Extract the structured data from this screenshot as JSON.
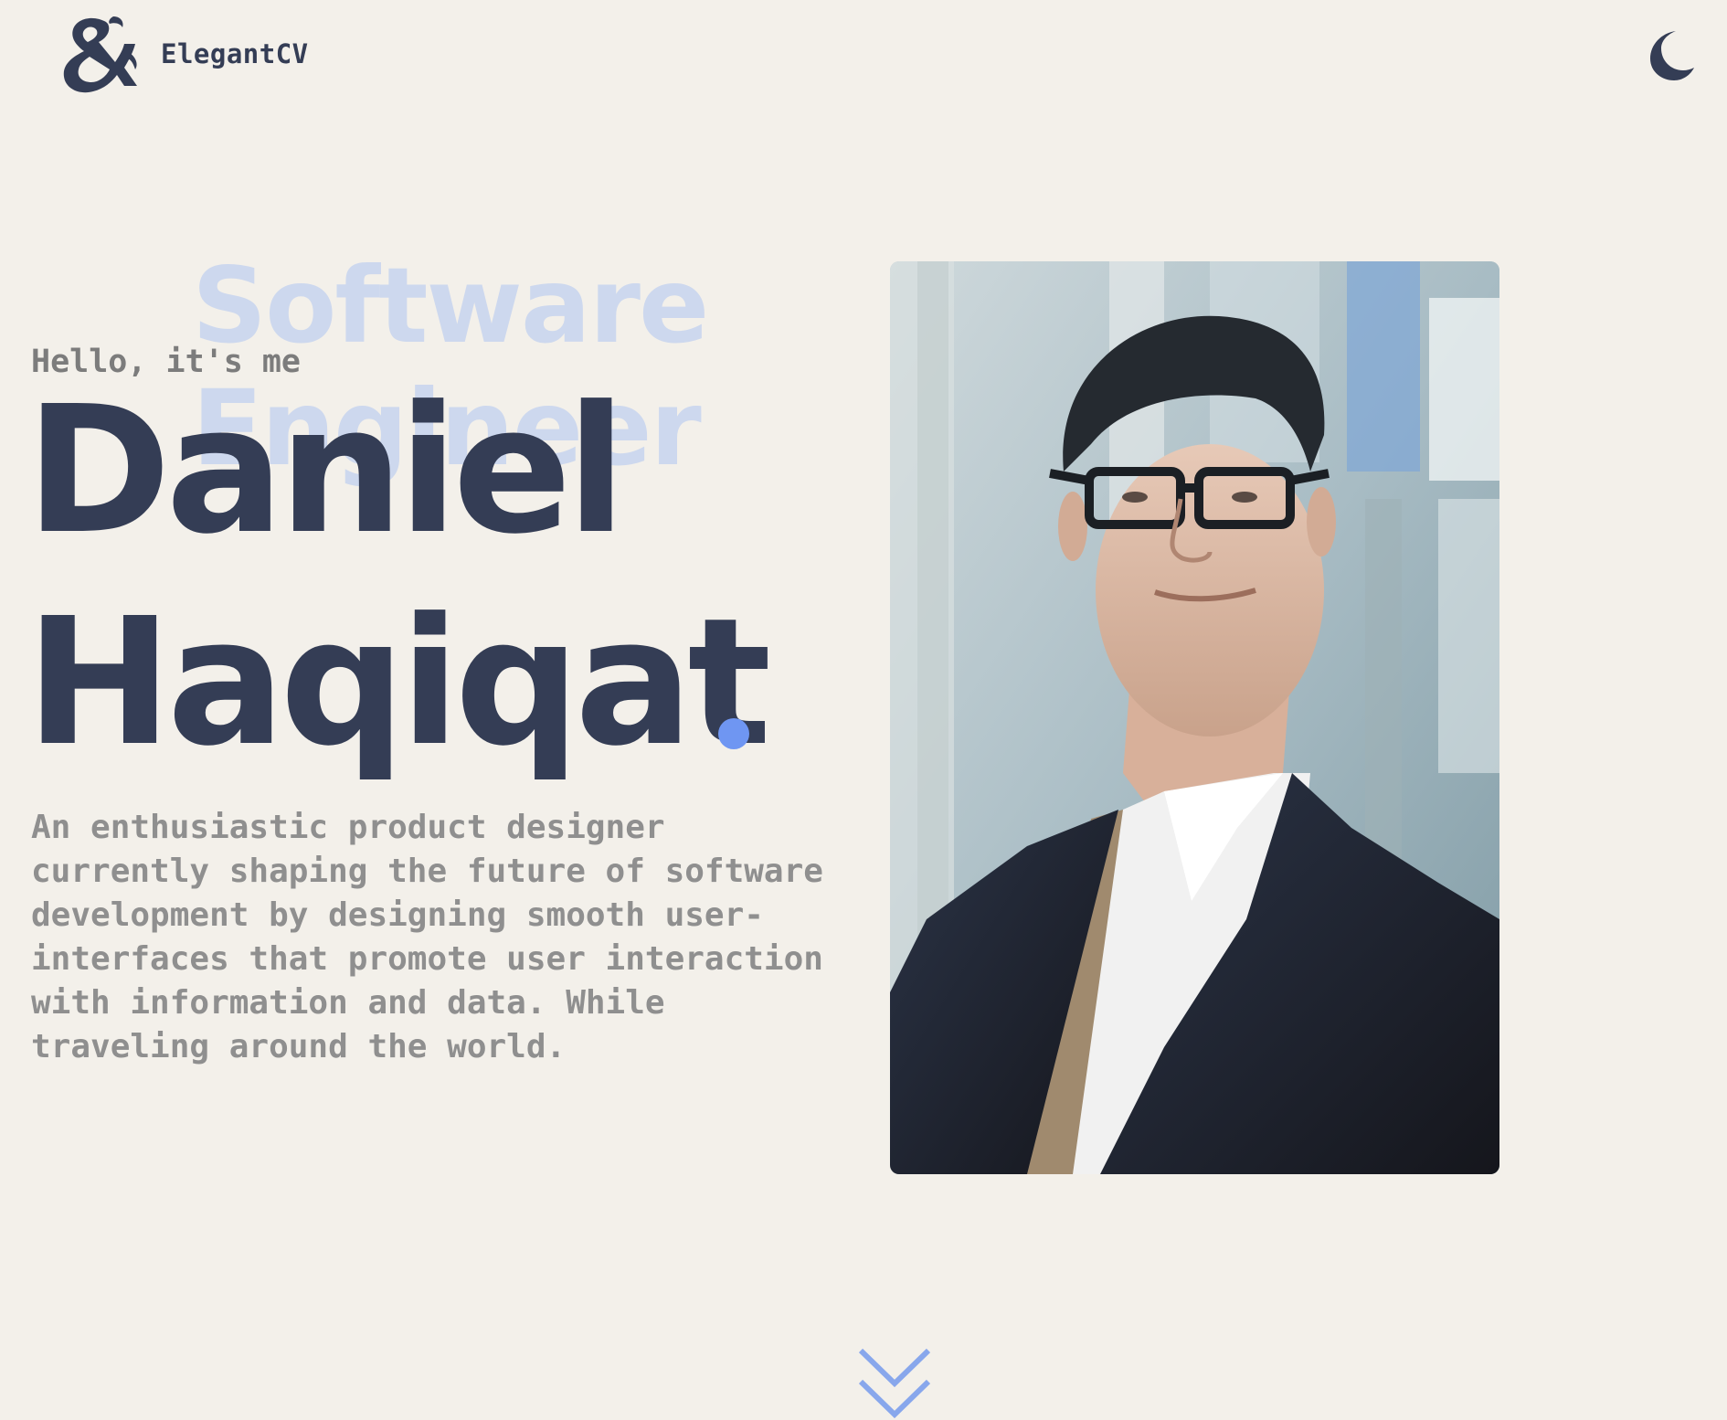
{
  "header": {
    "brand": "ElegantCV",
    "logo_icon": "ampersand-dragon-logo-icon",
    "theme_toggle_icon": "moon-icon"
  },
  "hero": {
    "background_title": "Software Engineer",
    "greeting": "Hello, it's me",
    "name_first": "Daniel",
    "name_last": "Haqiqat",
    "bio": "An enthusiastic product designer\ncurrently shaping the future of software\ndevelopment by designing smooth user-\ninterfaces that promote user interaction\nwith information and data. While\ntraveling around the world."
  },
  "scroll_indicator_icon": "double-chevron-down-icon",
  "colors": {
    "background": "#f3f0ea",
    "primary_text": "#343d55",
    "accent": "#6f96f2",
    "muted_title": "#cdd8ee",
    "body_text": "#8f8f8f"
  }
}
